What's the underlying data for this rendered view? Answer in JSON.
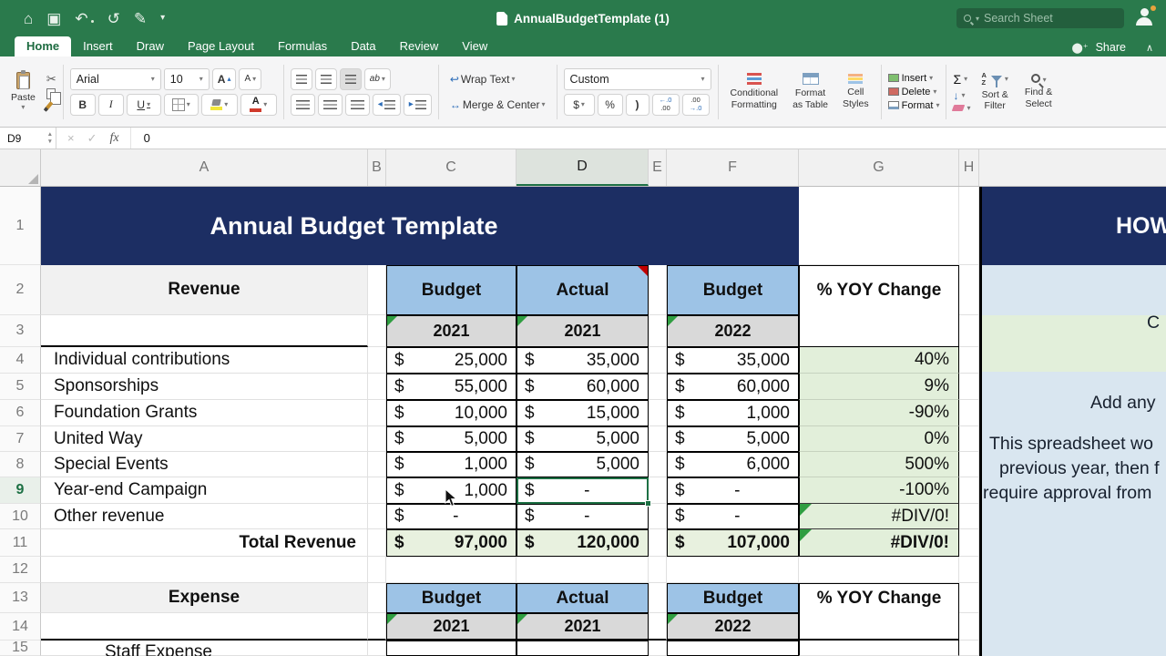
{
  "titlebar": {
    "doc_title": "AnnualBudgetTemplate (1)",
    "search_placeholder": "Search Sheet",
    "share_label": "Share"
  },
  "tabs": {
    "items": [
      "Home",
      "Insert",
      "Draw",
      "Page Layout",
      "Formulas",
      "Data",
      "Review",
      "View"
    ],
    "active": "Home"
  },
  "ribbon": {
    "paste": "Paste",
    "font_name": "Arial",
    "font_size": "10",
    "increase_font": "A",
    "decrease_font": "A",
    "bold": "B",
    "italic": "I",
    "underline": "U",
    "orientation": "ab",
    "wrap_text": "Wrap Text",
    "merge_center": "Merge & Center",
    "number_format": "Custom",
    "currency": "$",
    "percent": "%",
    "comma": ")",
    "inc_dec_top": "←.0",
    "inc_dec_bot": ".00",
    "dec_dec_top": ".00",
    "dec_dec_bot": "→.0",
    "cond_line1": "Conditional",
    "cond_line2": "Formatting",
    "table_line1": "Format",
    "table_line2": "as Table",
    "styles_line1": "Cell",
    "styles_line2": "Styles",
    "insert": "Insert",
    "delete": "Delete",
    "format": "Format",
    "autosum": "Σ",
    "sort_line1": "Sort &",
    "sort_line2": "Filter",
    "find_line1": "Find &",
    "find_line2": "Select"
  },
  "formula_bar": {
    "name_box": "D9",
    "fx": "fx",
    "value": "0"
  },
  "grid": {
    "col_headers": [
      "A",
      "B",
      "C",
      "D",
      "E",
      "F",
      "G",
      "H"
    ],
    "selected_col": "D",
    "row_headers": [
      "1",
      "2",
      "3",
      "4",
      "5",
      "6",
      "7",
      "8",
      "9",
      "10",
      "11",
      "12",
      "13",
      "14",
      "15"
    ],
    "selected_row": "9"
  },
  "sheet": {
    "title": "Annual Budget Template",
    "currency": "$",
    "revenue": {
      "label": "Revenue",
      "budget_h": "Budget",
      "actual_h": "Actual",
      "budget2_h": "Budget",
      "yoy_h": "% YOY Change",
      "year1": "2021",
      "year2": "2021",
      "year3": "2022",
      "rows": [
        {
          "label": "Individual contributions",
          "c": "25,000",
          "d": "35,000",
          "f": "35,000",
          "g": "40%"
        },
        {
          "label": "Sponsorships",
          "c": "55,000",
          "d": "60,000",
          "f": "60,000",
          "g": "9%"
        },
        {
          "label": "Foundation Grants",
          "c": "10,000",
          "d": "15,000",
          "f": "1,000",
          "g": "-90%"
        },
        {
          "label": "United Way",
          "c": "5,000",
          "d": "5,000",
          "f": "5,000",
          "g": "0%"
        },
        {
          "label": "Special Events",
          "c": "1,000",
          "d": "5,000",
          "f": "6,000",
          "g": "500%"
        },
        {
          "label": "Year-end Campaign",
          "c": "1,000",
          "d": "-",
          "f": "-",
          "g": "-100%"
        },
        {
          "label": "Other revenue",
          "c": "-",
          "d": "-",
          "f": "-",
          "g": "#DIV/0!"
        }
      ],
      "total": {
        "label": "Total Revenue",
        "c": "97,000",
        "d": "120,000",
        "f": "107,000",
        "g": "#DIV/0!"
      }
    },
    "expense": {
      "label": "Expense",
      "budget_h": "Budget",
      "actual_h": "Actual",
      "budget2_h": "Budget",
      "yoy_h": "% YOY Change",
      "year1": "2021",
      "year2": "2021",
      "year3": "2022",
      "row1_label": "Staff Expense"
    },
    "help": {
      "title": "HOW",
      "c_line": "C",
      "add_line": "Add any",
      "line1": "This spreadsheet wo",
      "line2": "previous year, then f",
      "line3": "require approval from"
    }
  }
}
